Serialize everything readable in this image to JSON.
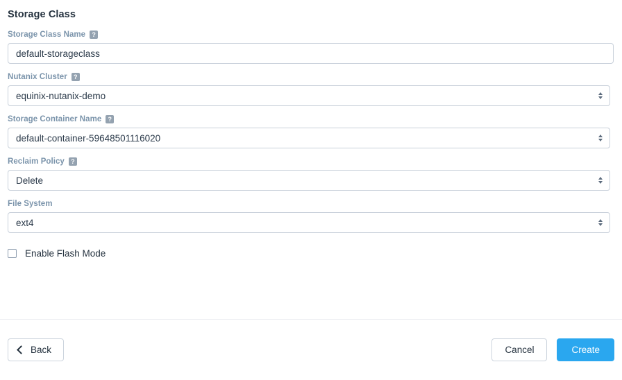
{
  "page": {
    "title": "Storage Class"
  },
  "fields": [
    {
      "label": "Storage Class Name",
      "help_icon": "help-question-icon",
      "help_glyph": "?",
      "has_help": true,
      "control": "text",
      "value": "default-storageclass",
      "placeholder": "",
      "name": "storage-class-name"
    },
    {
      "label": "Nutanix Cluster",
      "help_icon": "help-question-icon",
      "help_glyph": "?",
      "has_help": true,
      "control": "select",
      "value": "equinix-nutanix-demo",
      "name": "nutanix-cluster"
    },
    {
      "label": "Storage Container Name",
      "help_icon": "help-question-icon",
      "help_glyph": "?",
      "has_help": true,
      "control": "select",
      "value": "default-container-59648501116020",
      "name": "storage-container-name"
    },
    {
      "label": "Reclaim Policy",
      "help_icon": "help-question-icon",
      "help_glyph": "?",
      "has_help": true,
      "control": "select",
      "value": "Delete",
      "name": "reclaim-policy"
    },
    {
      "label": "File System",
      "help_icon": "",
      "help_glyph": "",
      "has_help": false,
      "control": "select",
      "value": "ext4",
      "name": "file-system"
    }
  ],
  "checkbox": {
    "label": "Enable Flash Mode",
    "checked": false
  },
  "footer": {
    "back_label": "Back",
    "back_icon": "chevron-left-icon",
    "cancel_label": "Cancel",
    "create_label": "Create"
  },
  "colors": {
    "primary": "#2aa7ef",
    "label": "#7b94ab",
    "title": "#25323f",
    "border": "#c8d0da",
    "help_badge": "#94a2b0"
  }
}
